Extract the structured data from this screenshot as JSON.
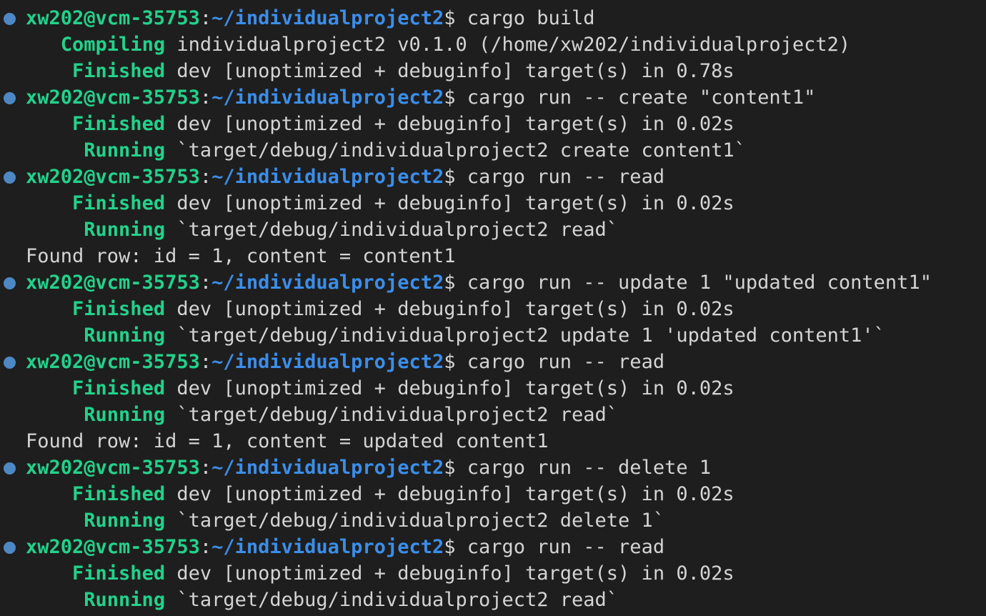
{
  "lines": [
    {
      "type": "prompt",
      "user": "xw202@vcm-35753",
      "path": "~/individualproject2",
      "cmd": "cargo build"
    },
    {
      "type": "status",
      "pad": "   ",
      "label": "Compiling",
      "text": "individualproject2 v0.1.0 (/home/xw202/individualproject2)"
    },
    {
      "type": "status",
      "pad": "    ",
      "label": "Finished",
      "text": "dev [unoptimized + debuginfo] target(s) in 0.78s"
    },
    {
      "type": "prompt",
      "user": "xw202@vcm-35753",
      "path": "~/individualproject2",
      "cmd": "cargo run -- create \"content1\""
    },
    {
      "type": "status",
      "pad": "    ",
      "label": "Finished",
      "text": "dev [unoptimized + debuginfo] target(s) in 0.02s"
    },
    {
      "type": "status",
      "pad": "     ",
      "label": "Running",
      "text": "`target/debug/individualproject2 create content1`"
    },
    {
      "type": "prompt",
      "user": "xw202@vcm-35753",
      "path": "~/individualproject2",
      "cmd": "cargo run -- read"
    },
    {
      "type": "status",
      "pad": "    ",
      "label": "Finished",
      "text": "dev [unoptimized + debuginfo] target(s) in 0.02s"
    },
    {
      "type": "status",
      "pad": "     ",
      "label": "Running",
      "text": "`target/debug/individualproject2 read`"
    },
    {
      "type": "plain",
      "text": "Found row: id = 1, content = content1"
    },
    {
      "type": "prompt",
      "user": "xw202@vcm-35753",
      "path": "~/individualproject2",
      "cmd": "cargo run -- update 1 \"updated content1\""
    },
    {
      "type": "status",
      "pad": "    ",
      "label": "Finished",
      "text": "dev [unoptimized + debuginfo] target(s) in 0.02s"
    },
    {
      "type": "status",
      "pad": "     ",
      "label": "Running",
      "text": "`target/debug/individualproject2 update 1 'updated content1'`"
    },
    {
      "type": "prompt",
      "user": "xw202@vcm-35753",
      "path": "~/individualproject2",
      "cmd": "cargo run -- read"
    },
    {
      "type": "status",
      "pad": "    ",
      "label": "Finished",
      "text": "dev [unoptimized + debuginfo] target(s) in 0.02s"
    },
    {
      "type": "status",
      "pad": "     ",
      "label": "Running",
      "text": "`target/debug/individualproject2 read`"
    },
    {
      "type": "plain",
      "text": "Found row: id = 1, content = updated content1"
    },
    {
      "type": "prompt",
      "user": "xw202@vcm-35753",
      "path": "~/individualproject2",
      "cmd": "cargo run -- delete 1"
    },
    {
      "type": "status",
      "pad": "    ",
      "label": "Finished",
      "text": "dev [unoptimized + debuginfo] target(s) in 0.02s"
    },
    {
      "type": "status",
      "pad": "     ",
      "label": "Running",
      "text": "`target/debug/individualproject2 delete 1`"
    },
    {
      "type": "prompt",
      "user": "xw202@vcm-35753",
      "path": "~/individualproject2",
      "cmd": "cargo run -- read"
    },
    {
      "type": "status",
      "pad": "    ",
      "label": "Finished",
      "text": "dev [unoptimized + debuginfo] target(s) in 0.02s"
    },
    {
      "type": "status",
      "pad": "     ",
      "label": "Running",
      "text": "`target/debug/individualproject2 read`"
    }
  ],
  "colors": {
    "background": "#1e1e1e",
    "user": "#23d18b",
    "path": "#3b8eea",
    "text": "#d4d4d4",
    "dot": "#4d88c4"
  }
}
